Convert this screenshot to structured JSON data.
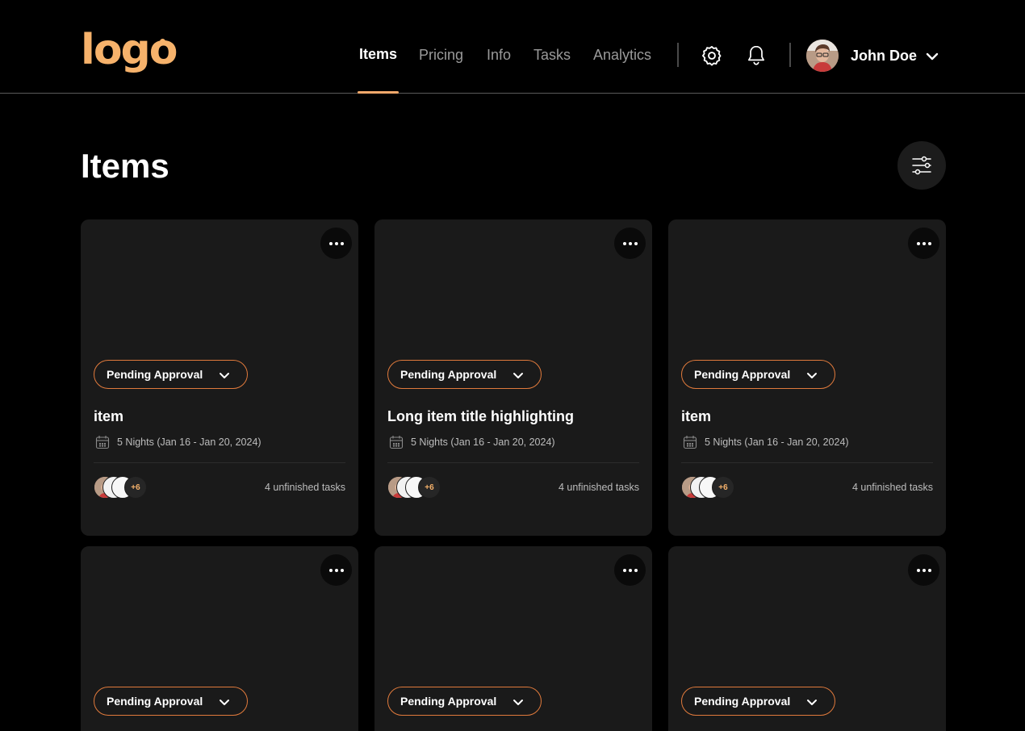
{
  "header": {
    "logo": "logo",
    "nav": [
      {
        "label": "Items",
        "active": true
      },
      {
        "label": "Pricing",
        "active": false
      },
      {
        "label": "Info",
        "active": false
      },
      {
        "label": "Tasks",
        "active": false
      },
      {
        "label": "Analytics",
        "active": false
      }
    ],
    "settings_icon": "gear-icon",
    "notifications_icon": "bell-icon",
    "user": {
      "name": "John Doe"
    }
  },
  "main": {
    "title": "Items",
    "filter_icon": "sliders-icon"
  },
  "cards": [
    {
      "status": "Pending Approval",
      "title": "item",
      "date": "5 Nights (Jan 16 - Jan 20, 2024)",
      "members_more": "+6",
      "tasks": "4 unfinished tasks"
    },
    {
      "status": "Pending Approval",
      "title": "Long item title highlighting",
      "date": "5 Nights (Jan 16 - Jan 20, 2024)",
      "members_more": "+6",
      "tasks": "4 unfinished tasks"
    },
    {
      "status": "Pending Approval",
      "title": "item",
      "date": "5 Nights (Jan 16 - Jan 20, 2024)",
      "members_more": "+6",
      "tasks": "4 unfinished tasks"
    },
    {
      "status": "Pending Approval"
    },
    {
      "status": "Pending Approval"
    },
    {
      "status": "Pending Approval"
    }
  ],
  "colors": {
    "accent": "#f6b26b",
    "status_border": "#e07a3c",
    "card_bg": "#1a1a1a",
    "background": "#000000"
  }
}
